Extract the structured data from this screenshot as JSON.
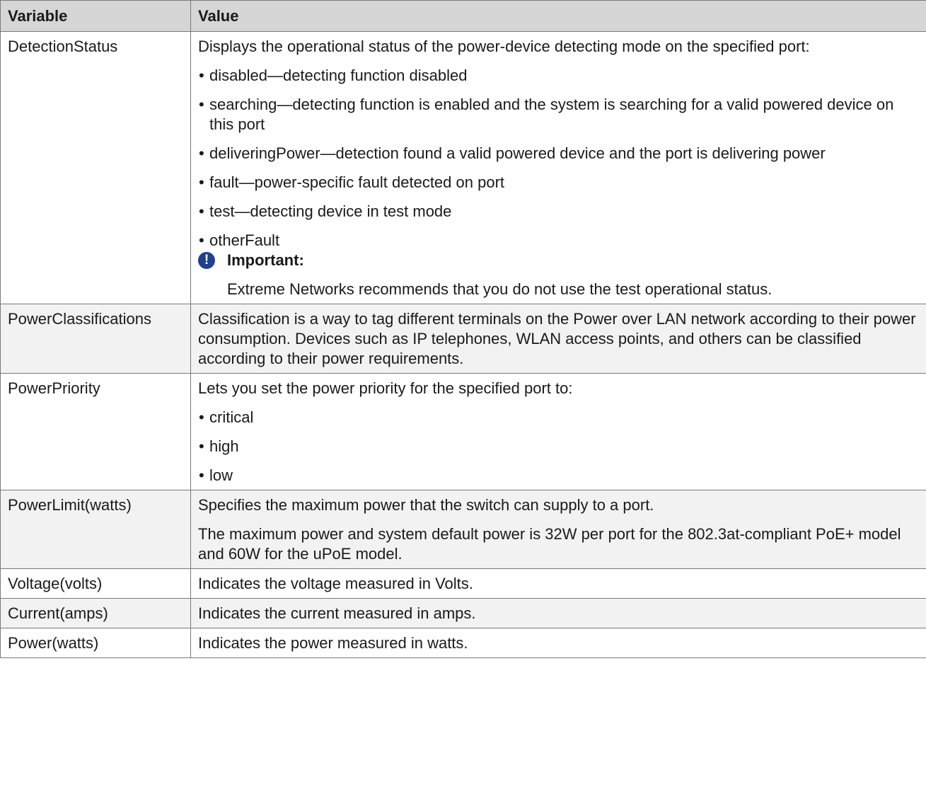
{
  "header": {
    "col_variable": "Variable",
    "col_value": "Value"
  },
  "rows": [
    {
      "variable": "DetectionStatus",
      "intro": "Displays the operational status of the power-device detecting mode on the specified port:",
      "bullets": [
        "disabled—detecting function disabled",
        "searching—detecting function is enabled and the system is searching for a valid powered device on this port",
        "deliveringPower—detection found a valid powered device and the port is delivering power",
        "fault—power-specific fault detected on port",
        "test—detecting device in test mode",
        "otherFault"
      ],
      "note_title": "Important:",
      "note_text": "Extreme Networks recommends that you do not use the test operational status."
    },
    {
      "variable": "PowerClassifications",
      "text": "Classification is a way to tag different terminals on the Power over LAN network according to their power consumption. Devices such as IP telephones, WLAN access points, and others can be classified according to their power requirements."
    },
    {
      "variable": "PowerPriority",
      "intro": "Lets you set the power priority for the specified port to:",
      "bullets": [
        "critical",
        "high",
        "low"
      ]
    },
    {
      "variable": "PowerLimit(watts)",
      "text": "Specifies the maximum power that the switch can supply to a port.",
      "text2": "The maximum power and system default power is 32W per port for the 802.3at-compliant PoE+ model and 60W for the uPoE model."
    },
    {
      "variable": "Voltage(volts)",
      "text": "Indicates the voltage measured in Volts."
    },
    {
      "variable": "Current(amps)",
      "text": "Indicates the current measured in amps."
    },
    {
      "variable": "Power(watts)",
      "text": "Indicates the power measured in watts."
    }
  ]
}
